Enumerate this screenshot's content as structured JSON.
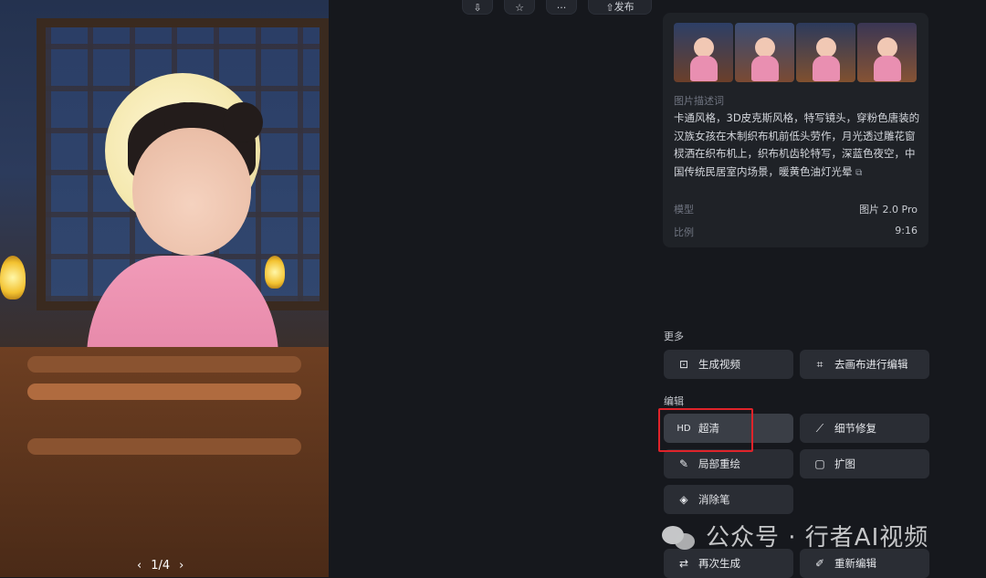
{
  "viewer": {
    "pager": "1/4",
    "prev_icon": "chevron-left-icon",
    "next_icon": "chevron-right-icon"
  },
  "toolbar": {
    "download_icon": "download-icon",
    "star_icon": "star-icon",
    "more_icon": "more-icon",
    "publish_label": "发布",
    "download_glyph": "⇩",
    "star_glyph": "☆",
    "more_glyph": "···",
    "publish_glyph": "⇧"
  },
  "detail": {
    "prompt_label": "图片描述词",
    "prompt_text": "卡通风格，3D皮克斯风格，特写镜头，穿粉色唐装的汉族女孩在木制织布机前低头劳作，月光透过雕花窗棂洒在织布机上，织布机齿轮特写，深蓝色夜空，中国传统民居室内场景，暖黄色油灯光晕",
    "copy_icon": "copy-icon",
    "copy_glyph": "⧉",
    "model_label": "模型",
    "model_value": "图片 2.0 Pro",
    "ratio_label": "比例",
    "ratio_value": "9:16"
  },
  "more_section": {
    "title": "更多",
    "buttons": [
      {
        "label": "生成视频",
        "icon": "video-icon",
        "glyph": "⊡"
      },
      {
        "label": "去画布进行编辑",
        "icon": "canvas-icon",
        "glyph": "⌗"
      }
    ]
  },
  "edit_section": {
    "title": "编辑",
    "buttons": [
      {
        "label": "超清",
        "icon": "hd-icon",
        "glyph": "HD"
      },
      {
        "label": "细节修复",
        "icon": "magic-wand-icon",
        "glyph": "⟋"
      },
      {
        "label": "局部重绘",
        "icon": "brush-icon",
        "glyph": "✎"
      },
      {
        "label": "扩图",
        "icon": "expand-icon",
        "glyph": "▢"
      },
      {
        "label": "消除笔",
        "icon": "eraser-icon",
        "glyph": "◈"
      },
      {
        "label": "再次生成",
        "icon": "regenerate-icon",
        "glyph": "⇄"
      },
      {
        "label": "重新编辑",
        "icon": "edit-icon",
        "glyph": "✐"
      }
    ]
  },
  "watermark": {
    "text": "公众号 · 行者AI视频"
  },
  "colors": {
    "background": "#16181d",
    "card": "#1f2227",
    "button": "#2a2d34",
    "highlight": "#e0232a"
  }
}
